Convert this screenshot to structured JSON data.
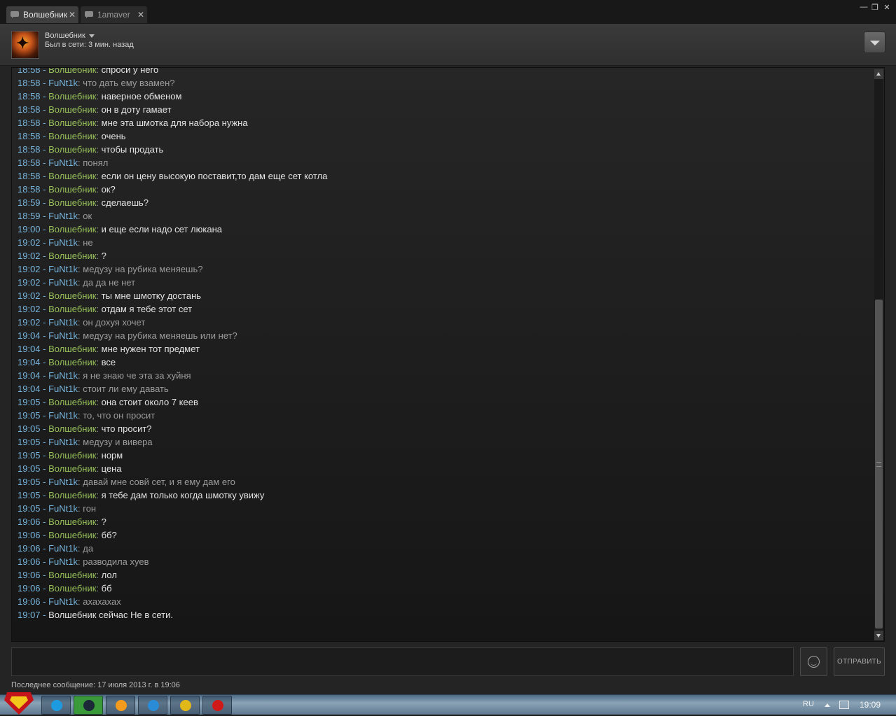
{
  "tabs": [
    {
      "label": "Волшебник",
      "close": "✕",
      "active": true
    },
    {
      "label": "1amaver",
      "close": "✕",
      "active": false
    }
  ],
  "window_controls": {
    "minimize": "—",
    "restore": "❐",
    "close": "✕"
  },
  "header": {
    "username": "Волшебник",
    "status": "Был в сети: 3 мин. назад"
  },
  "messages": [
    {
      "time": "18:58",
      "author": "Волшебник",
      "role": "friend",
      "text": "спроси у него"
    },
    {
      "time": "18:58",
      "author": "FuNt1k",
      "role": "me",
      "text": "что дать ему взамен?"
    },
    {
      "time": "18:58",
      "author": "Волшебник",
      "role": "friend",
      "text": "наверное обменом"
    },
    {
      "time": "18:58",
      "author": "Волшебник",
      "role": "friend",
      "text": "он в доту гамает"
    },
    {
      "time": "18:58",
      "author": "Волшебник",
      "role": "friend",
      "text": "мне эта шмотка для набора нужна"
    },
    {
      "time": "18:58",
      "author": "Волшебник",
      "role": "friend",
      "text": "очень"
    },
    {
      "time": "18:58",
      "author": "Волшебник",
      "role": "friend",
      "text": "чтобы продать"
    },
    {
      "time": "18:58",
      "author": "FuNt1k",
      "role": "me",
      "text": "понял"
    },
    {
      "time": "18:58",
      "author": "Волшебник",
      "role": "friend",
      "text": "если он цену высокую поставит,то дам еще сет котла"
    },
    {
      "time": "18:58",
      "author": "Волшебник",
      "role": "friend",
      "text": "ок?"
    },
    {
      "time": "18:59",
      "author": "Волшебник",
      "role": "friend",
      "text": "сделаешь?"
    },
    {
      "time": "18:59",
      "author": "FuNt1k",
      "role": "me",
      "text": "ок"
    },
    {
      "time": "19:00",
      "author": "Волшебник",
      "role": "friend",
      "text": "и еще если надо сет люкана"
    },
    {
      "time": "19:02",
      "author": "FuNt1k",
      "role": "me",
      "text": "не"
    },
    {
      "time": "19:02",
      "author": "Волшебник",
      "role": "friend",
      "text": "?"
    },
    {
      "time": "19:02",
      "author": "FuNt1k",
      "role": "me",
      "text": "медузу на рубика меняешь?"
    },
    {
      "time": "19:02",
      "author": "FuNt1k",
      "role": "me",
      "text": "да да не нет"
    },
    {
      "time": "19:02",
      "author": "Волшебник",
      "role": "friend",
      "text": "ты мне шмотку достань"
    },
    {
      "time": "19:02",
      "author": "Волшебник",
      "role": "friend",
      "text": "отдам я тебе этот сет"
    },
    {
      "time": "19:02",
      "author": "FuNt1k",
      "role": "me",
      "text": "он дохуя хочет"
    },
    {
      "time": "19:04",
      "author": "FuNt1k",
      "role": "me",
      "text": "медузу на рубика меняешь или нет?"
    },
    {
      "time": "19:04",
      "author": "Волшебник",
      "role": "friend",
      "text": "мне нужен тот предмет"
    },
    {
      "time": "19:04",
      "author": "Волшебник",
      "role": "friend",
      "text": "все"
    },
    {
      "time": "19:04",
      "author": "FuNt1k",
      "role": "me",
      "text": "я не знаю че эта за хуйня"
    },
    {
      "time": "19:04",
      "author": "FuNt1k",
      "role": "me",
      "text": "стоит ли ему давать"
    },
    {
      "time": "19:05",
      "author": "Волшебник",
      "role": "friend",
      "text": "она стоит около 7 кеев"
    },
    {
      "time": "19:05",
      "author": "FuNt1k",
      "role": "me",
      "text": "то, что он просит"
    },
    {
      "time": "19:05",
      "author": "Волшебник",
      "role": "friend",
      "text": "что просит?"
    },
    {
      "time": "19:05",
      "author": "FuNt1k",
      "role": "me",
      "text": "медузу и вивера"
    },
    {
      "time": "19:05",
      "author": "Волшебник",
      "role": "friend",
      "text": "норм"
    },
    {
      "time": "19:05",
      "author": "Волшебник",
      "role": "friend",
      "text": "цена"
    },
    {
      "time": "19:05",
      "author": "FuNt1k",
      "role": "me",
      "text": "давай мне совй сет, и я ему дам его"
    },
    {
      "time": "19:05",
      "author": "Волшебник",
      "role": "friend",
      "text": "я тебе дам только когда шмотку увижу"
    },
    {
      "time": "19:05",
      "author": "FuNt1k",
      "role": "me",
      "text": "гон"
    },
    {
      "time": "19:06",
      "author": "Волшебник",
      "role": "friend",
      "text": "?"
    },
    {
      "time": "19:06",
      "author": "Волшебник",
      "role": "friend",
      "text": "бб?"
    },
    {
      "time": "19:06",
      "author": "FuNt1k",
      "role": "me",
      "text": "да"
    },
    {
      "time": "19:06",
      "author": "FuNt1k",
      "role": "me",
      "text": "разводила хуев"
    },
    {
      "time": "19:06",
      "author": "Волшебник",
      "role": "friend",
      "text": "лол"
    },
    {
      "time": "19:06",
      "author": "Волшебник",
      "role": "friend",
      "text": "бб"
    },
    {
      "time": "19:06",
      "author": "FuNt1k",
      "role": "me",
      "text": "ахахахах"
    },
    {
      "time": "19:07",
      "author": "",
      "role": "sys",
      "text": "Волшебник сейчас Не в сети."
    }
  ],
  "composer": {
    "input_value": "",
    "send_label": "ОТПРАВИТЬ"
  },
  "footer": {
    "last_message": "Последнее сообщение: 17 июля 2013 г. в 19:06"
  },
  "taskbar": {
    "apps": [
      {
        "name": "skype-icon",
        "color": "#1e9be0"
      },
      {
        "name": "steam-icon",
        "color": "#1b2838"
      },
      {
        "name": "halflife-icon",
        "color": "#f39b1c"
      },
      {
        "name": "maxthon-icon",
        "color": "#2a8bd6"
      },
      {
        "name": "chrome-icon",
        "color": "#e0b81a"
      },
      {
        "name": "opera-icon",
        "color": "#d01a1a"
      }
    ],
    "lang": "RU",
    "clock": "19:09"
  },
  "colors": {
    "friend_name": "#97c05a",
    "my_name": "#76b4dc",
    "timestamp": "#76b4dc"
  }
}
